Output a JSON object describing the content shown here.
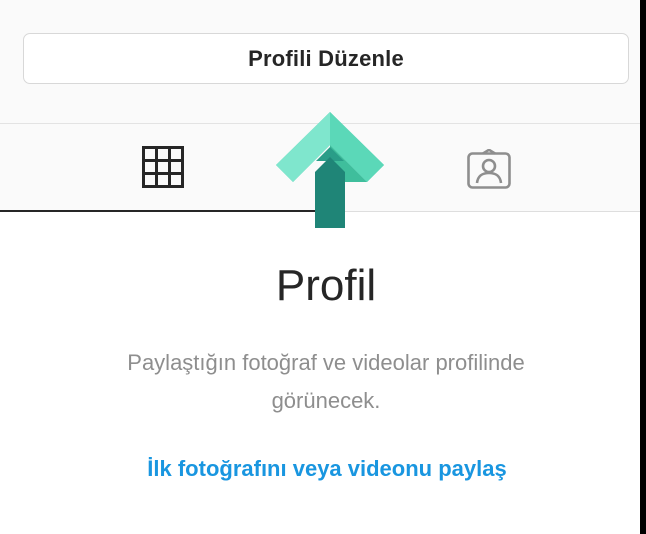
{
  "profile": {
    "edit_button_label": "Profili Düzenle"
  },
  "tabs": [
    {
      "name": "grid",
      "icon": "grid-icon",
      "selected": true
    },
    {
      "name": "tagged",
      "icon": "tagged-person-icon",
      "selected": false
    }
  ],
  "empty_state": {
    "title": "Profil",
    "description": "Paylaştığın fotoğraf ve videolar profilinde görünecek.",
    "action_link": "İlk fotoğrafını veya videonu paylaş"
  },
  "colors": {
    "link": "#1996e0",
    "arrow_light": "#6fe0c4",
    "arrow_mid": "#4fd0ae",
    "arrow_dark": "#1f8577"
  }
}
